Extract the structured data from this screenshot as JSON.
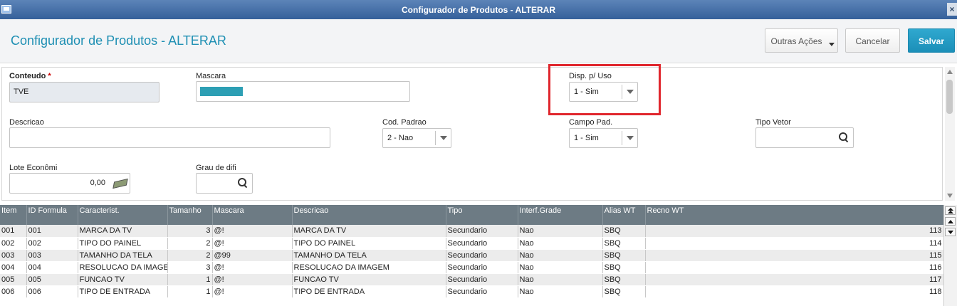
{
  "window": {
    "title": "Configurador de Produtos - ALTERAR",
    "close_glyph": "×"
  },
  "header": {
    "page_title": "Configurador de Produtos - ALTERAR",
    "outras_label": "Outras Ações",
    "cancelar_label": "Cancelar",
    "salvar_label": "Salvar",
    "accent": "#1e8fb3"
  },
  "form": {
    "conteudo": {
      "label": "Conteudo",
      "required_mark": "*",
      "value": "TVE"
    },
    "mascara": {
      "label": "Mascara"
    },
    "disp_uso": {
      "label": "Disp. p/ Uso",
      "value": "1 - Sim"
    },
    "descricao": {
      "label": "Descricao",
      "value": ""
    },
    "cod_padrao": {
      "label": "Cod. Padrao",
      "value": "2 - Nao"
    },
    "campo_pad": {
      "label": "Campo Pad.",
      "value": "1 - Sim"
    },
    "tipo_vetor": {
      "label": "Tipo Vetor",
      "value": ""
    },
    "lote_economico": {
      "label": "Lote Econômi",
      "value": "0,00"
    },
    "grau_dificuldade": {
      "label": "Grau de difi",
      "value": ""
    }
  },
  "grid": {
    "columns": [
      "Item",
      "ID Formula",
      "Caracterist.",
      "Tamanho",
      "Mascara",
      "Descricao",
      "Tipo",
      "Interf.Grade",
      "Alias WT",
      "Recno WT"
    ],
    "rows": [
      [
        "001",
        "001",
        "MARCA DA TV",
        "3",
        "@!",
        "MARCA DA TV",
        "Secundario",
        "Nao",
        "SBQ",
        "113"
      ],
      [
        "002",
        "002",
        "TIPO DO PAINEL",
        "2",
        "@!",
        "TIPO DO PAINEL",
        "Secundario",
        "Nao",
        "SBQ",
        "114"
      ],
      [
        "003",
        "003",
        "TAMANHO DA TELA",
        "2",
        "@99",
        "TAMANHO DA TELA",
        "Secundario",
        "Nao",
        "SBQ",
        "115"
      ],
      [
        "004",
        "004",
        "RESOLUCAO DA IMAGE",
        "3",
        "@!",
        "RESOLUCAO DA IMAGEM",
        "Secundario",
        "Nao",
        "SBQ",
        "116"
      ],
      [
        "005",
        "005",
        "FUNCAO TV",
        "1",
        "@!",
        "FUNCAO TV",
        "Secundario",
        "Nao",
        "SBQ",
        "117"
      ],
      [
        "006",
        "006",
        "TIPO DE ENTRADA",
        "1",
        "@!",
        "TIPO DE ENTRADA",
        "Secundario",
        "Nao",
        "SBQ",
        "118"
      ]
    ]
  }
}
